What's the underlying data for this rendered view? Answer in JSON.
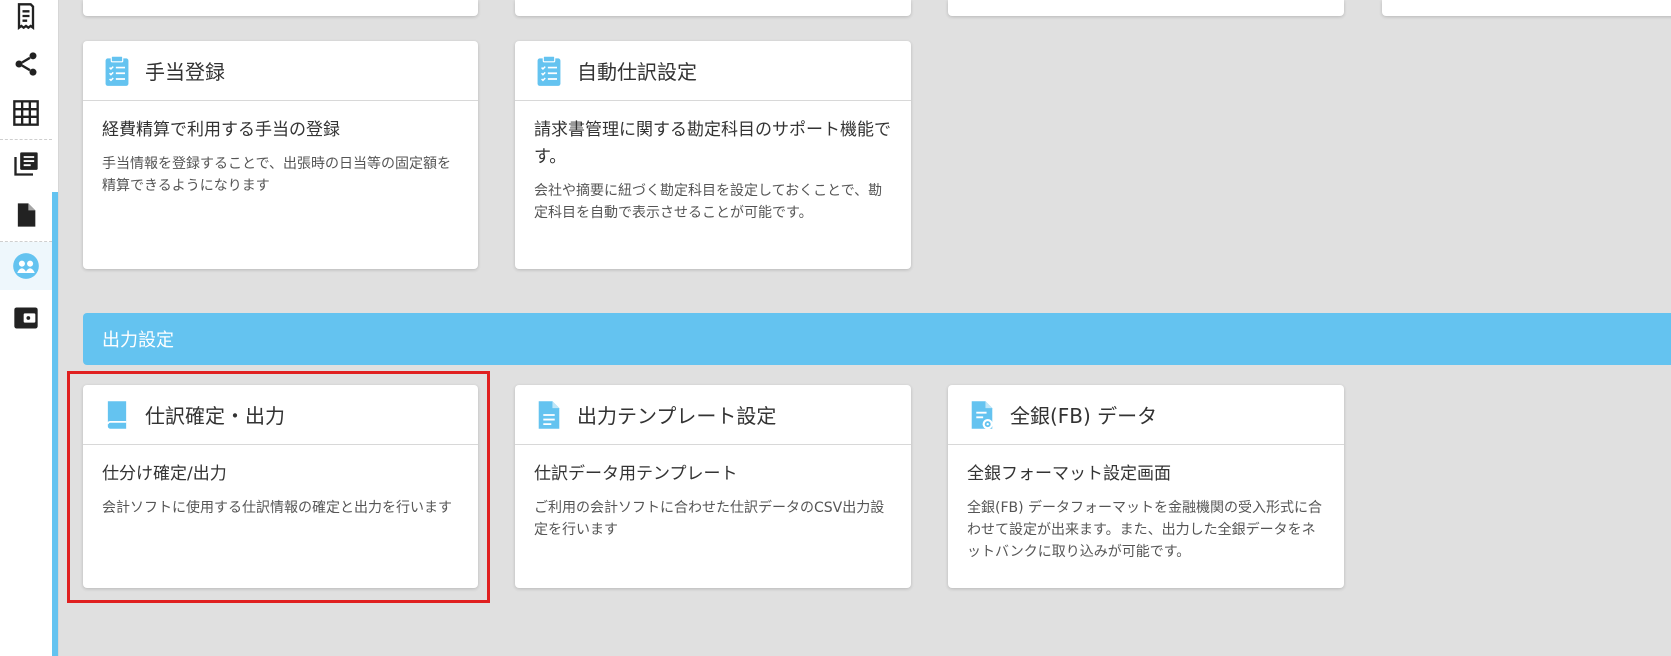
{
  "colors": {
    "accent": "#64c3f0",
    "highlight": "#e02020"
  },
  "sidebar": {
    "items": [
      {
        "icon": "receipt-icon"
      },
      {
        "icon": "share-icon"
      },
      {
        "icon": "grid-table-icon"
      },
      {
        "icon": "library-books-icon"
      },
      {
        "icon": "document-icon"
      },
      {
        "icon": "users-icon",
        "active": true
      },
      {
        "icon": "wallet-icon"
      }
    ]
  },
  "cards_row1": [
    {
      "icon": "clipboard-list-icon",
      "title": "手当登録",
      "subtitle": "経費精算で利用する手当の登録",
      "desc": "手当情報を登録することで、出張時の日当等の固定額を精算できるようになります"
    },
    {
      "icon": "clipboard-list-icon",
      "title": "自動仕訳設定",
      "subtitle": "請求書管理に関する勘定科目のサポート機能です。",
      "desc": "会社や摘要に紐づく勘定科目を設定しておくことで、勘定科目を自動で表示させることが可能です。"
    }
  ],
  "section": {
    "title": "出力設定"
  },
  "cards_row2": [
    {
      "icon": "book-icon",
      "title": "仕訳確定・出力",
      "subtitle": "仕分け確定/出力",
      "desc": "会計ソフトに使用する仕訳情報の確定と出力を行います"
    },
    {
      "icon": "file-text-icon",
      "title": "出力テンプレート設定",
      "subtitle": "仕訳データ用テンプレート",
      "desc": "ご利用の会計ソフトに合わせた仕訳データのCSV出力設定を行います"
    },
    {
      "icon": "file-settings-icon",
      "title": "全銀(FB) データ",
      "subtitle": "全銀フォーマット設定画面",
      "desc": "全銀(FB) データフォーマットを金融機関の受入形式に合わせて設定が出来ます。また、出力した全銀データをネットバンクに取り込みが可能です。"
    }
  ]
}
